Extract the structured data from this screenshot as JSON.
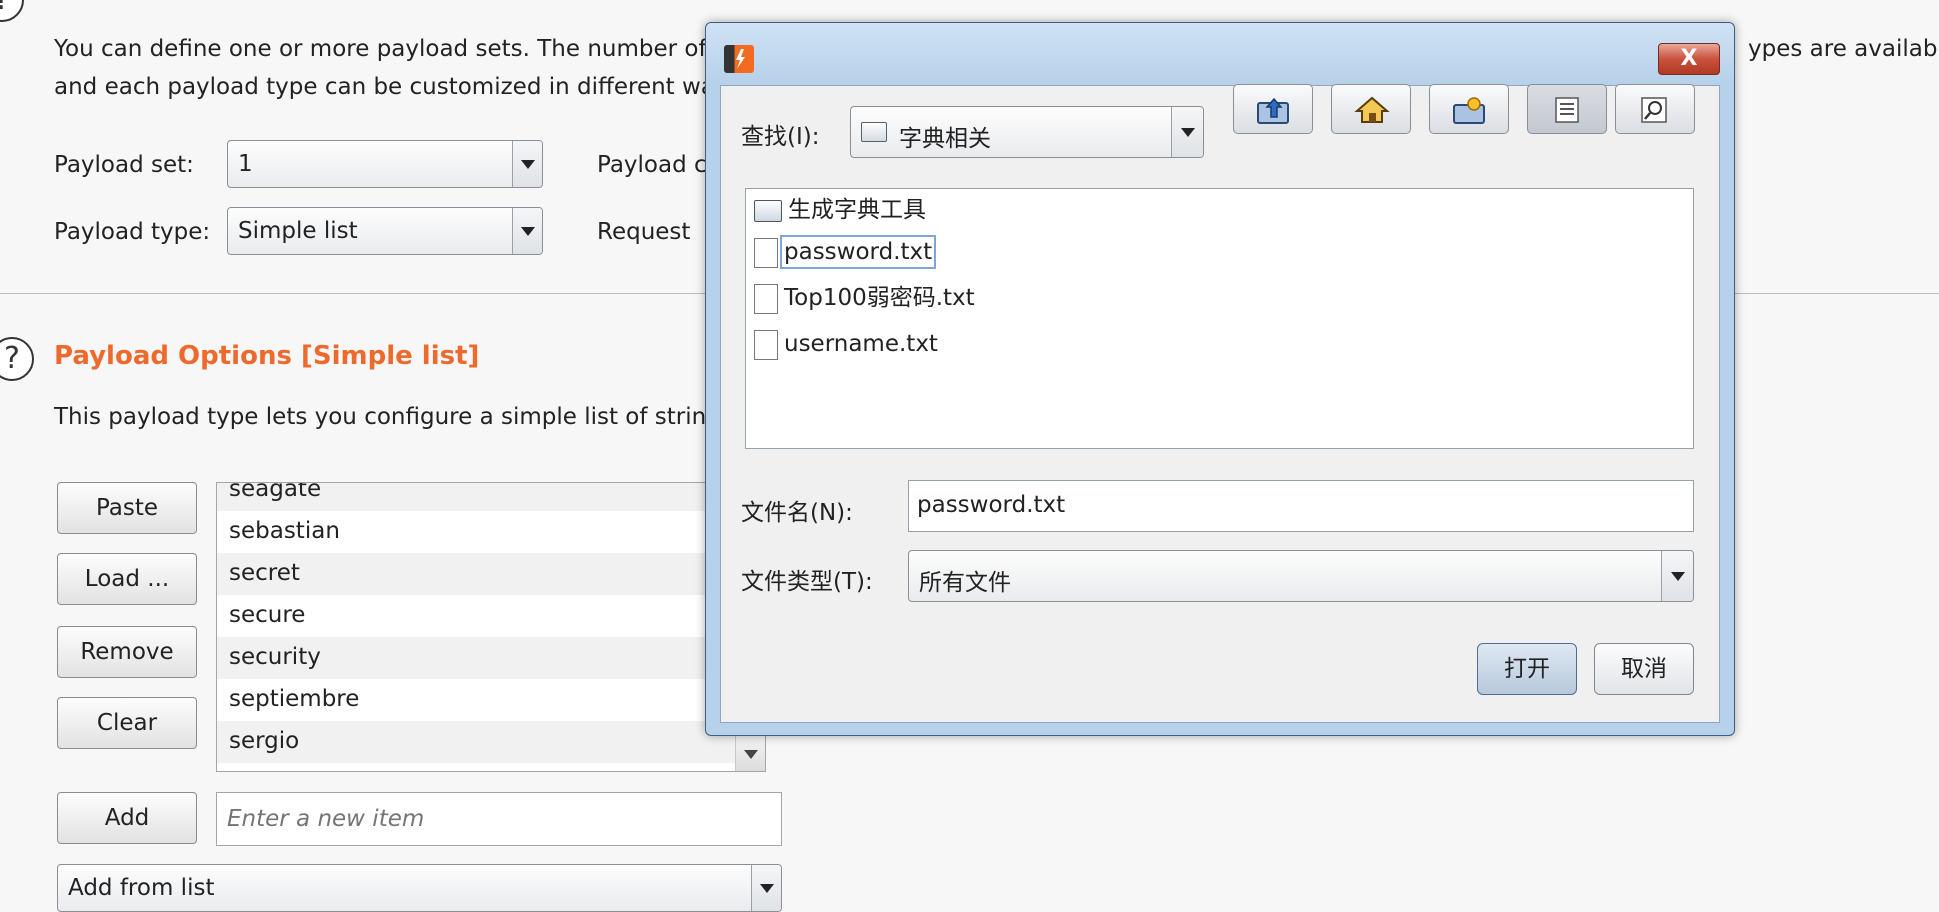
{
  "intro_text": {
    "line1_start": "You can define one or more payload sets. The number of",
    "line1_end": "ypes are available",
    "line2": "and each payload type can be customized in different wa"
  },
  "payload_sets": {
    "set_label": "Payload set:",
    "set_value": "1",
    "type_label": "Payload type:",
    "type_value": "Simple list",
    "count_label": "Payload c",
    "request_label": "Request"
  },
  "payload_options": {
    "title": "Payload Options [Simple list]",
    "description": "This payload type lets you configure a simple list of strin",
    "buttons": {
      "paste": "Paste",
      "load": "Load ...",
      "remove": "Remove",
      "clear": "Clear",
      "add": "Add"
    },
    "items": [
      "seagate",
      "sebastian",
      "secret",
      "secure",
      "security",
      "septiembre",
      "sergio"
    ],
    "new_item_placeholder": "Enter a new item",
    "add_from_list": "Add from list"
  },
  "file_dialog": {
    "close_label": "X",
    "look_in_label": "查找(I):",
    "look_in_value": "字典相关",
    "tool_buttons": [
      "up-folder-icon",
      "home-icon",
      "new-folder-icon",
      "list-view-icon",
      "details-view-icon"
    ],
    "files": [
      {
        "name": "生成字典工具",
        "type": "folder"
      },
      {
        "name": "password.txt",
        "type": "file",
        "selected": true
      },
      {
        "name": "Top100弱密码.txt",
        "type": "file"
      },
      {
        "name": "username.txt",
        "type": "file"
      }
    ],
    "file_name_label": "文件名(N):",
    "file_name_value": "password.txt",
    "file_type_label": "文件类型(T):",
    "file_type_value": "所有文件",
    "open_button": "打开",
    "cancel_button": "取消"
  },
  "colors": {
    "accent_orange": "#ee6a2c",
    "dialog_frame": "#b7d1ea",
    "close_red": "#c9523d"
  }
}
